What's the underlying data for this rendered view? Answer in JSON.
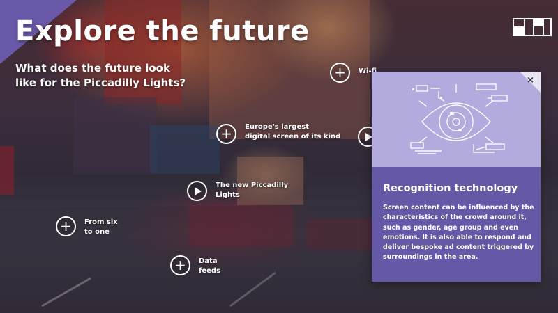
{
  "page": {
    "title": "Explore the future",
    "subtitle": "What does the future look like for the Piccadilly Lights?"
  },
  "hotspots": [
    {
      "name": "hotspot-wifi",
      "icon": "plus-icon",
      "label": "Wi-fi"
    },
    {
      "name": "hotspot-largest-screen",
      "icon": "plus-icon",
      "label": "Europe's largest\ndigital screen of its kind"
    },
    {
      "name": "hotspot-extra-video",
      "icon": "play-icon",
      "label": ""
    },
    {
      "name": "hotspot-new-lights",
      "icon": "play-icon",
      "label": "The new Piccadilly\nLights"
    },
    {
      "name": "hotspot-six-to-one",
      "icon": "plus-icon",
      "label": "From six\nto one"
    },
    {
      "name": "hotspot-data-feeds",
      "icon": "plus-icon",
      "label": "Data\nfeeds"
    }
  ],
  "panel": {
    "title": "Recognition technology",
    "body": "Screen content can be influenced by the characteristics of the crowd around it, such as gender, age group and even emotions. It is also able to respond and deliver bespoke ad content triggered by surroundings in the area.",
    "close_label": "×",
    "illustration": "eye-recognition-icon"
  },
  "colors": {
    "accent_purple": "#6558a7",
    "illustration_bg": "#b3aade",
    "corner_purple": "#6a58a8"
  }
}
